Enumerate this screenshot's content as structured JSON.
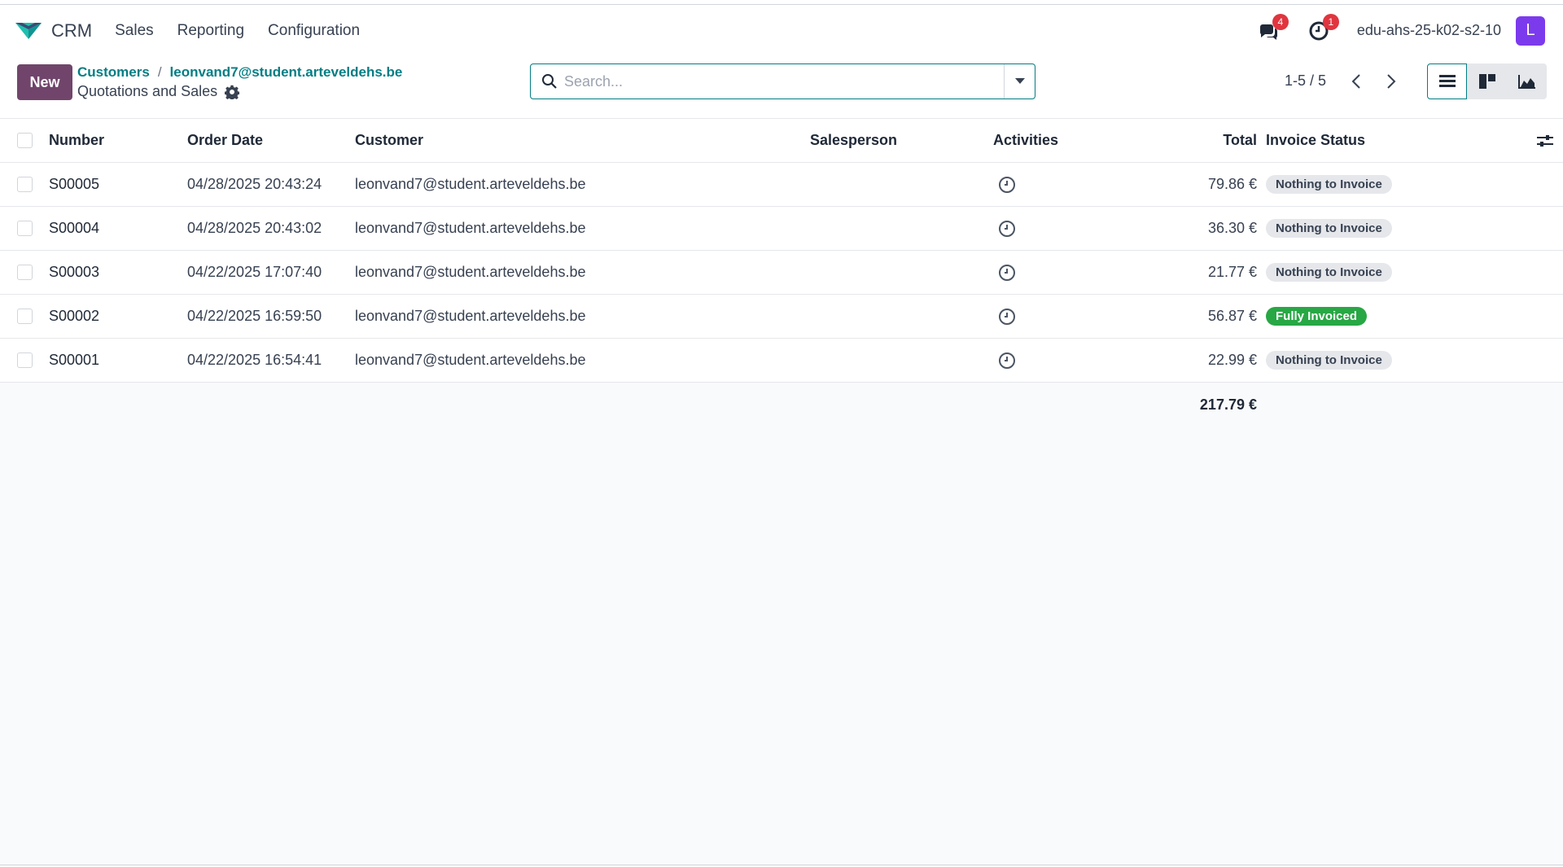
{
  "navbar": {
    "app_name": "CRM",
    "menu": [
      "Sales",
      "Reporting",
      "Configuration"
    ],
    "messages_count": "4",
    "activities_count": "1",
    "db_name": "edu-ahs-25-k02-s2-10",
    "avatar_letter": "L"
  },
  "control": {
    "new_label": "New",
    "breadcrumb": [
      "Customers",
      "leonvand7@student.arteveldehs.be"
    ],
    "breadcrumb_sep": "/",
    "subtitle": "Quotations and Sales",
    "search_placeholder": "Search...",
    "pager": "1-5 / 5"
  },
  "table": {
    "headers": {
      "number": "Number",
      "order_date": "Order Date",
      "customer": "Customer",
      "salesperson": "Salesperson",
      "activities": "Activities",
      "total": "Total",
      "invoice_status": "Invoice Status"
    },
    "rows": [
      {
        "number": "S00005",
        "date": "04/28/2025 20:43:24",
        "customer": "leonvand7@student.arteveldehs.be",
        "total": "79.86 €",
        "status": "Nothing to Invoice"
      },
      {
        "number": "S00004",
        "date": "04/28/2025 20:43:02",
        "customer": "leonvand7@student.arteveldehs.be",
        "total": "36.30 €",
        "status": "Nothing to Invoice"
      },
      {
        "number": "S00003",
        "date": "04/22/2025 17:07:40",
        "customer": "leonvand7@student.arteveldehs.be",
        "total": "21.77 €",
        "status": "Nothing to Invoice"
      },
      {
        "number": "S00002",
        "date": "04/22/2025 16:59:50",
        "customer": "leonvand7@student.arteveldehs.be",
        "total": "56.87 €",
        "status": "Fully Invoiced"
      },
      {
        "number": "S00001",
        "date": "04/22/2025 16:54:41",
        "customer": "leonvand7@student.arteveldehs.be",
        "total": "22.99 €",
        "status": "Nothing to Invoice"
      }
    ],
    "grand_total": "217.79 €"
  },
  "colors": {
    "brand": "#71456b",
    "accent": "#017e84",
    "success": "#28a745"
  }
}
